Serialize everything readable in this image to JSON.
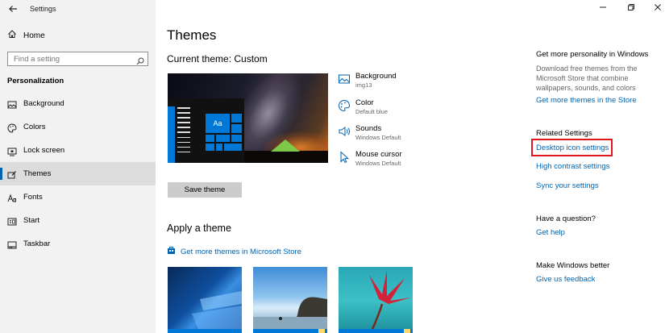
{
  "window": {
    "title": "Settings"
  },
  "sidebar": {
    "home_label": "Home",
    "search_placeholder": "Find a setting",
    "section_label": "Personalization",
    "items": [
      {
        "label": "Background",
        "icon": "image-icon"
      },
      {
        "label": "Colors",
        "icon": "palette-icon"
      },
      {
        "label": "Lock screen",
        "icon": "lock-screen-icon"
      },
      {
        "label": "Themes",
        "icon": "themes-brush-icon",
        "active": true
      },
      {
        "label": "Fonts",
        "icon": "fonts-icon"
      },
      {
        "label": "Start",
        "icon": "start-icon"
      },
      {
        "label": "Taskbar",
        "icon": "taskbar-icon"
      }
    ]
  },
  "main": {
    "title": "Themes",
    "current_theme": "Current theme: Custom",
    "properties": [
      {
        "title": "Background",
        "value": "img13",
        "icon": "image-icon"
      },
      {
        "title": "Color",
        "value": "Default blue",
        "icon": "palette-icon"
      },
      {
        "title": "Sounds",
        "value": "Windows Default",
        "icon": "speaker-icon"
      },
      {
        "title": "Mouse cursor",
        "value": "Windows Default",
        "icon": "cursor-icon"
      }
    ],
    "save_button": "Save theme",
    "apply_heading": "Apply a theme",
    "store_link": "Get more themes in Microsoft Store",
    "preview_tile_text": "Aa"
  },
  "right": {
    "personality_heading": "Get more personality in Windows",
    "personality_text": "Download free themes from the Microsoft Store that combine wallpapers, sounds, and colors",
    "personality_link": "Get more themes in the Store",
    "related_heading": "Related Settings",
    "related_links": [
      "Desktop icon settings",
      "High contrast settings",
      "Sync your settings"
    ],
    "question_heading": "Have a question?",
    "question_link": "Get help",
    "better_heading": "Make Windows better",
    "better_link": "Give us feedback"
  },
  "colors": {
    "accent": "#0063b1",
    "tile_blue": "#0078d7",
    "highlight": "#e0161e"
  }
}
